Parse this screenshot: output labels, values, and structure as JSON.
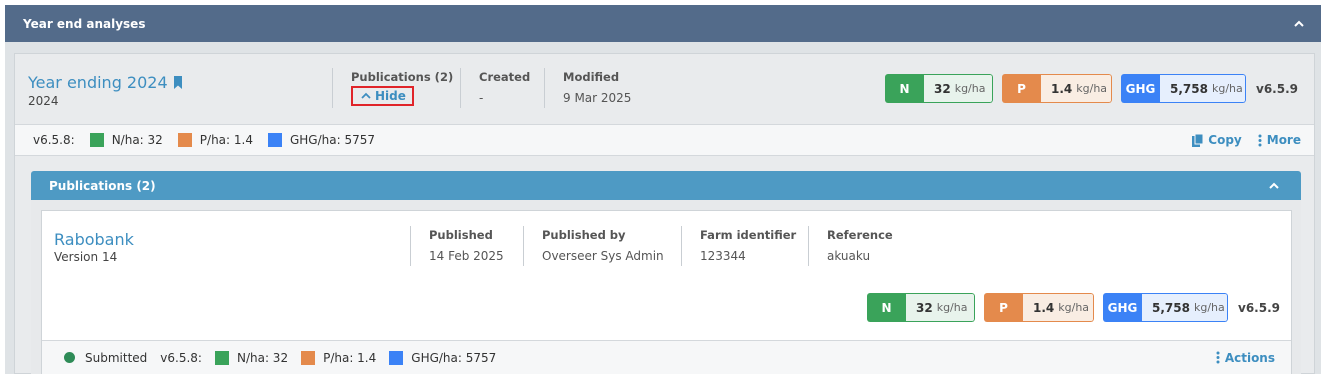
{
  "section": {
    "title": "Year end analyses"
  },
  "analysis": {
    "title": "Year ending 2024",
    "subtitle": "2024",
    "publications_label": "Publications (2)",
    "hide_label": "Hide",
    "created_label": "Created",
    "created_value": "-",
    "modified_label": "Modified",
    "modified_value": "9 Mar 2025",
    "kpis": [
      {
        "key": "N",
        "value": "32",
        "unit": "kg/ha"
      },
      {
        "key": "P",
        "value": "1.4",
        "unit": "kg/ha"
      },
      {
        "key": "GHG",
        "value": "5,758",
        "unit": "kg/ha"
      }
    ],
    "version": "v6.5.9",
    "summary_version": "v6.5.8:",
    "summary": [
      {
        "label": "N/ha: 32",
        "color": "#3aa35a"
      },
      {
        "label": "P/ha: 1.4",
        "color": "#e48a4c"
      },
      {
        "label": "GHG/ha: 5757",
        "color": "#3b82f6"
      }
    ],
    "copy_label": "Copy",
    "more_label": "More"
  },
  "publications": {
    "title": "Publications (2)",
    "item": {
      "title": "Rabobank",
      "subtitle": "Version 14",
      "published_label": "Published",
      "published_value": "14 Feb 2025",
      "published_by_label": "Published by",
      "published_by_value": "Overseer Sys Admin",
      "farm_id_label": "Farm identifier",
      "farm_id_value": "123344",
      "reference_label": "Reference",
      "reference_value": "akuaku",
      "kpis": [
        {
          "key": "N",
          "value": "32",
          "unit": "kg/ha"
        },
        {
          "key": "P",
          "value": "1.4",
          "unit": "kg/ha"
        },
        {
          "key": "GHG",
          "value": "5,758",
          "unit": "kg/ha"
        }
      ],
      "version": "v6.5.9",
      "status": "Submitted",
      "status_color": "#2e8b57",
      "summary_version": "v6.5.8:",
      "summary": [
        {
          "label": "N/ha: 32",
          "color": "#3aa35a"
        },
        {
          "label": "P/ha: 1.4",
          "color": "#e48a4c"
        },
        {
          "label": "GHG/ha: 5757",
          "color": "#3b82f6"
        }
      ],
      "actions_label": "Actions"
    }
  }
}
